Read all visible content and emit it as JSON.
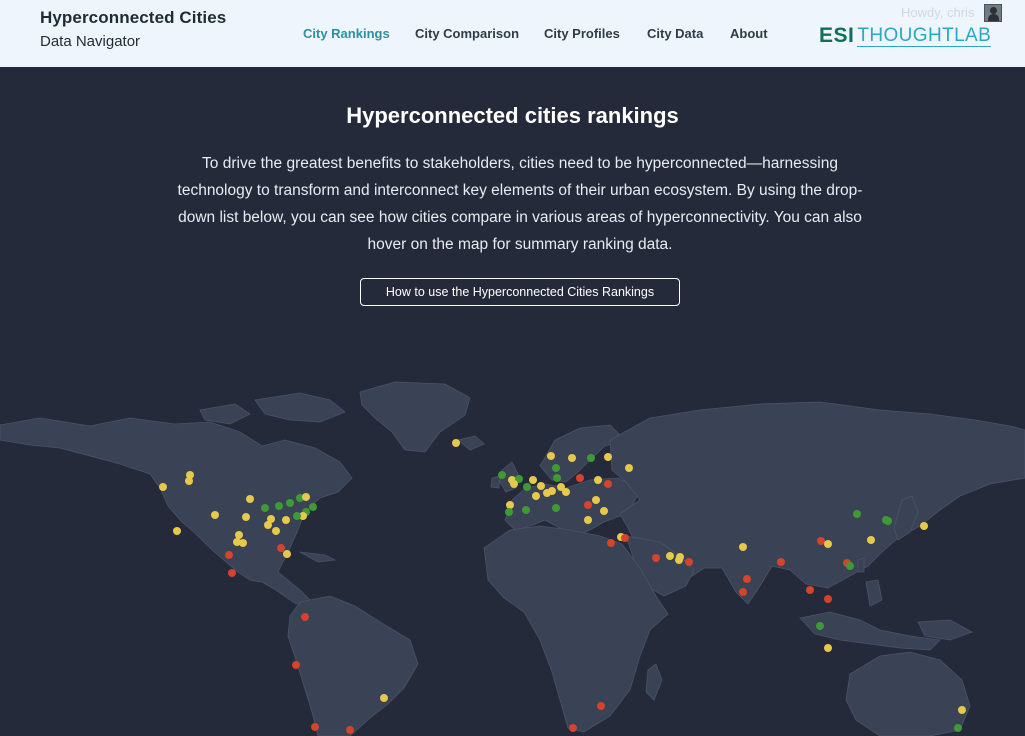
{
  "header": {
    "brand_title": "Hyperconnected Cities",
    "brand_subtitle": "Data Navigator",
    "nav": [
      {
        "label": "City Rankings",
        "active": true
      },
      {
        "label": "City Comparison",
        "active": false
      },
      {
        "label": "City Profiles",
        "active": false
      },
      {
        "label": "City Data",
        "active": false
      },
      {
        "label": "About",
        "active": false
      }
    ],
    "logo": {
      "part1": "ESI",
      "part2": "THOUGHTLAB"
    },
    "user": {
      "greeting": "Howdy, chris",
      "avatar_icon": "user-avatar-icon"
    }
  },
  "main": {
    "title": "Hyperconnected cities rankings",
    "intro": "To drive the greatest benefits to stakeholders, cities need to be hyperconnected—harnessing technology to transform and interconnect key elements of their urban ecosystem. By using the drop-down list below, you can see how cities compare in various areas of hyperconnectivity. You can also hover on the map for summary ranking data.",
    "how_to_button": "How to use the Hyperconnected Cities Rankings"
  },
  "colors": {
    "background": "#252a3a",
    "land": "#3a4256",
    "header_bg": "#eef5fc",
    "accent": "#2f8ea1",
    "dot_high": "#3f9a36",
    "dot_mid": "#e6c84a",
    "dot_low": "#d4432a"
  }
}
